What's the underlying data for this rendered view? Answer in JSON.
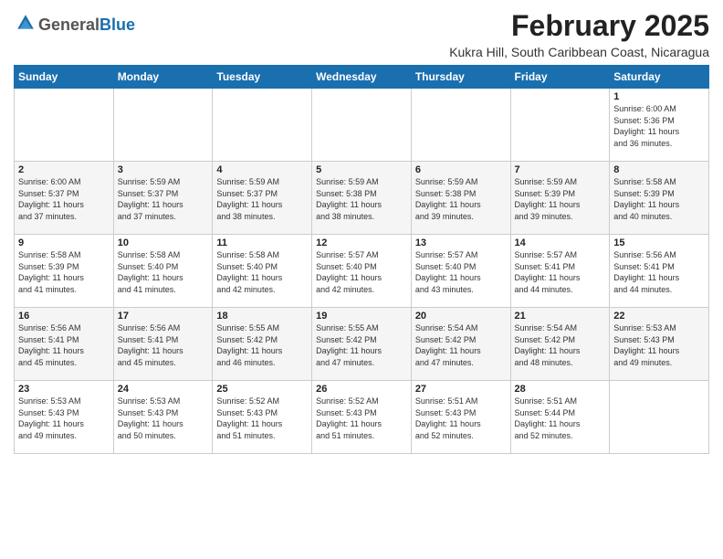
{
  "logo": {
    "general": "General",
    "blue": "Blue"
  },
  "header": {
    "title": "February 2025",
    "subtitle": "Kukra Hill, South Caribbean Coast, Nicaragua"
  },
  "weekdays": [
    "Sunday",
    "Monday",
    "Tuesday",
    "Wednesday",
    "Thursday",
    "Friday",
    "Saturday"
  ],
  "weeks": [
    [
      {
        "day": "",
        "info": ""
      },
      {
        "day": "",
        "info": ""
      },
      {
        "day": "",
        "info": ""
      },
      {
        "day": "",
        "info": ""
      },
      {
        "day": "",
        "info": ""
      },
      {
        "day": "",
        "info": ""
      },
      {
        "day": "1",
        "info": "Sunrise: 6:00 AM\nSunset: 5:36 PM\nDaylight: 11 hours\nand 36 minutes."
      }
    ],
    [
      {
        "day": "2",
        "info": "Sunrise: 6:00 AM\nSunset: 5:37 PM\nDaylight: 11 hours\nand 37 minutes."
      },
      {
        "day": "3",
        "info": "Sunrise: 5:59 AM\nSunset: 5:37 PM\nDaylight: 11 hours\nand 37 minutes."
      },
      {
        "day": "4",
        "info": "Sunrise: 5:59 AM\nSunset: 5:37 PM\nDaylight: 11 hours\nand 38 minutes."
      },
      {
        "day": "5",
        "info": "Sunrise: 5:59 AM\nSunset: 5:38 PM\nDaylight: 11 hours\nand 38 minutes."
      },
      {
        "day": "6",
        "info": "Sunrise: 5:59 AM\nSunset: 5:38 PM\nDaylight: 11 hours\nand 39 minutes."
      },
      {
        "day": "7",
        "info": "Sunrise: 5:59 AM\nSunset: 5:39 PM\nDaylight: 11 hours\nand 39 minutes."
      },
      {
        "day": "8",
        "info": "Sunrise: 5:58 AM\nSunset: 5:39 PM\nDaylight: 11 hours\nand 40 minutes."
      }
    ],
    [
      {
        "day": "9",
        "info": "Sunrise: 5:58 AM\nSunset: 5:39 PM\nDaylight: 11 hours\nand 41 minutes."
      },
      {
        "day": "10",
        "info": "Sunrise: 5:58 AM\nSunset: 5:40 PM\nDaylight: 11 hours\nand 41 minutes."
      },
      {
        "day": "11",
        "info": "Sunrise: 5:58 AM\nSunset: 5:40 PM\nDaylight: 11 hours\nand 42 minutes."
      },
      {
        "day": "12",
        "info": "Sunrise: 5:57 AM\nSunset: 5:40 PM\nDaylight: 11 hours\nand 42 minutes."
      },
      {
        "day": "13",
        "info": "Sunrise: 5:57 AM\nSunset: 5:40 PM\nDaylight: 11 hours\nand 43 minutes."
      },
      {
        "day": "14",
        "info": "Sunrise: 5:57 AM\nSunset: 5:41 PM\nDaylight: 11 hours\nand 44 minutes."
      },
      {
        "day": "15",
        "info": "Sunrise: 5:56 AM\nSunset: 5:41 PM\nDaylight: 11 hours\nand 44 minutes."
      }
    ],
    [
      {
        "day": "16",
        "info": "Sunrise: 5:56 AM\nSunset: 5:41 PM\nDaylight: 11 hours\nand 45 minutes."
      },
      {
        "day": "17",
        "info": "Sunrise: 5:56 AM\nSunset: 5:41 PM\nDaylight: 11 hours\nand 45 minutes."
      },
      {
        "day": "18",
        "info": "Sunrise: 5:55 AM\nSunset: 5:42 PM\nDaylight: 11 hours\nand 46 minutes."
      },
      {
        "day": "19",
        "info": "Sunrise: 5:55 AM\nSunset: 5:42 PM\nDaylight: 11 hours\nand 47 minutes."
      },
      {
        "day": "20",
        "info": "Sunrise: 5:54 AM\nSunset: 5:42 PM\nDaylight: 11 hours\nand 47 minutes."
      },
      {
        "day": "21",
        "info": "Sunrise: 5:54 AM\nSunset: 5:42 PM\nDaylight: 11 hours\nand 48 minutes."
      },
      {
        "day": "22",
        "info": "Sunrise: 5:53 AM\nSunset: 5:43 PM\nDaylight: 11 hours\nand 49 minutes."
      }
    ],
    [
      {
        "day": "23",
        "info": "Sunrise: 5:53 AM\nSunset: 5:43 PM\nDaylight: 11 hours\nand 49 minutes."
      },
      {
        "day": "24",
        "info": "Sunrise: 5:53 AM\nSunset: 5:43 PM\nDaylight: 11 hours\nand 50 minutes."
      },
      {
        "day": "25",
        "info": "Sunrise: 5:52 AM\nSunset: 5:43 PM\nDaylight: 11 hours\nand 51 minutes."
      },
      {
        "day": "26",
        "info": "Sunrise: 5:52 AM\nSunset: 5:43 PM\nDaylight: 11 hours\nand 51 minutes."
      },
      {
        "day": "27",
        "info": "Sunrise: 5:51 AM\nSunset: 5:43 PM\nDaylight: 11 hours\nand 52 minutes."
      },
      {
        "day": "28",
        "info": "Sunrise: 5:51 AM\nSunset: 5:44 PM\nDaylight: 11 hours\nand 52 minutes."
      },
      {
        "day": "",
        "info": ""
      }
    ]
  ]
}
